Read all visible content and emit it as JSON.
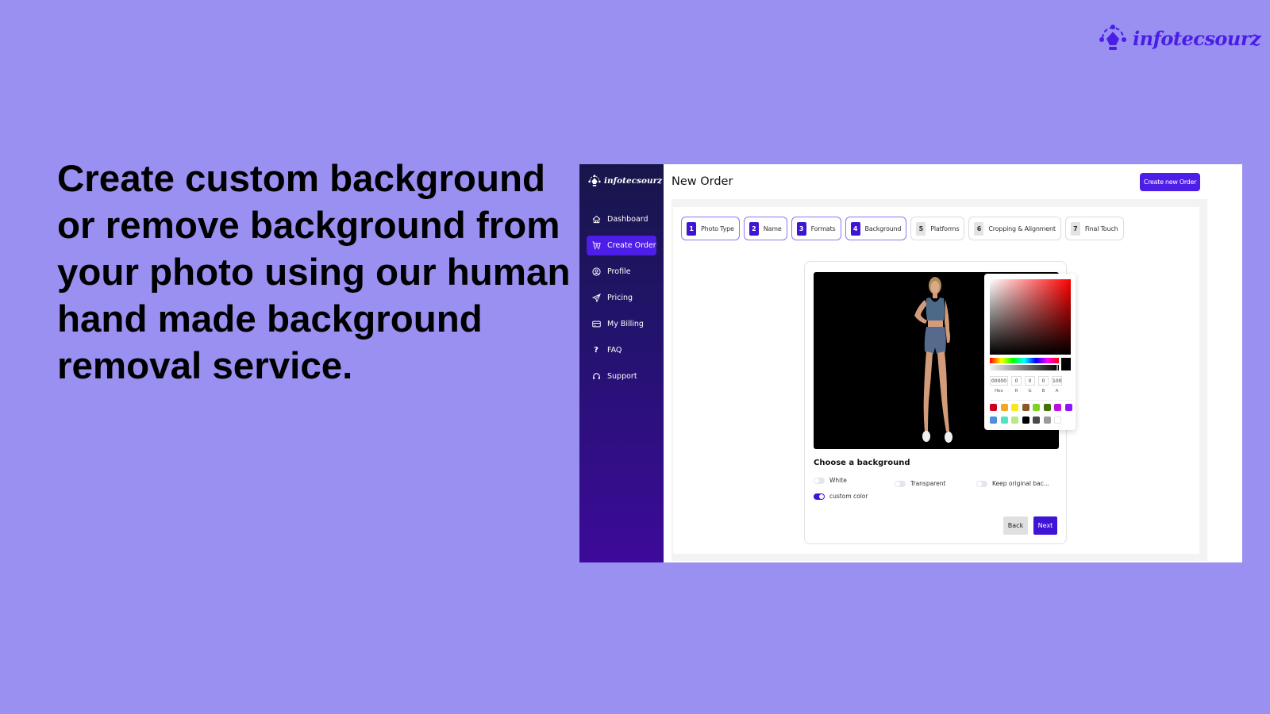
{
  "brand": {
    "name": "infotecsourz",
    "accent_color": "#4a1ee6"
  },
  "headline": "Create custom background or remove background from your photo using our human hand made background removal service.",
  "app": {
    "sidebar": {
      "logo_text": "infotecsourz",
      "items": [
        {
          "label": "Dashboard",
          "icon": "home-icon",
          "active": false
        },
        {
          "label": "Create Order",
          "icon": "cart-icon",
          "active": true
        },
        {
          "label": "Profile",
          "icon": "user-circle-icon",
          "active": false
        },
        {
          "label": "Pricing",
          "icon": "send-icon",
          "active": false
        },
        {
          "label": "My Billing",
          "icon": "credit-card-icon",
          "active": false
        },
        {
          "label": "FAQ",
          "icon": "question-icon",
          "active": false
        },
        {
          "label": "Support",
          "icon": "headset-icon",
          "active": false
        }
      ]
    },
    "header": {
      "title": "New Order",
      "create_button": "Create new Order"
    },
    "steps": [
      {
        "num": "1",
        "label": "Photo Type",
        "done": true
      },
      {
        "num": "2",
        "label": "Name",
        "done": true
      },
      {
        "num": "3",
        "label": "Formats",
        "done": true
      },
      {
        "num": "4",
        "label": "Background",
        "done": true
      },
      {
        "num": "5",
        "label": "Platforms",
        "done": false
      },
      {
        "num": "6",
        "label": "Cropping & Alignment",
        "done": false
      },
      {
        "num": "7",
        "label": "Final Touch",
        "done": false
      }
    ],
    "color_picker": {
      "hex": "00000",
      "r": "0",
      "g": "0",
      "b": "0",
      "a": "100",
      "labels": {
        "hex": "Hex",
        "r": "R",
        "g": "G",
        "b": "B",
        "a": "A"
      },
      "swatches": [
        "#d0021b",
        "#f5a623",
        "#f8e71c",
        "#8b572a",
        "#7ed321",
        "#417505",
        "#bd10e0",
        "#9013fe",
        "#4a90e2",
        "#50e3c2",
        "#b8e986",
        "#000000",
        "#4a4a4a",
        "#9b9b9b",
        "#ffffff"
      ]
    },
    "background": {
      "heading": "Choose a background",
      "options": [
        {
          "label": "White",
          "on": false
        },
        {
          "label": "Transparent",
          "on": false
        },
        {
          "label": "Keep original bac...",
          "on": false
        },
        {
          "label": "custom color",
          "on": true
        }
      ]
    },
    "buttons": {
      "back": "Back",
      "next": "Next"
    }
  }
}
